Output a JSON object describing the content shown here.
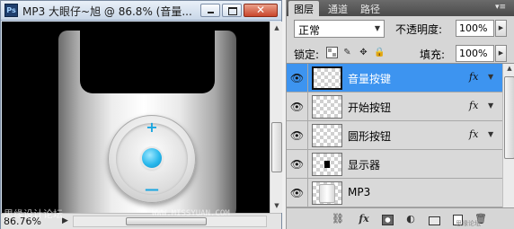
{
  "document": {
    "title": "MP3 大眼仔~旭 @ 86.8% (音量...",
    "zoom": "86.76%",
    "close_glyph": "✕"
  },
  "canvas": {
    "plus_glyph": "+",
    "minus_glyph": "—",
    "accent_color": "#29b8ec"
  },
  "watermark": {
    "left": "思缘设计论坛",
    "right": "WWW.MISSYUAN.COM"
  },
  "panel": {
    "tabs": [
      "图层",
      "通道",
      "路径"
    ],
    "active_tab": "图层",
    "menu_glyph": "▾≡",
    "blend_mode": "正常",
    "opacity_label": "不透明度:",
    "opacity_value": "100%",
    "lock_label": "锁定:",
    "fill_label": "填充:",
    "fill_value": "100%",
    "footer_watermark": "思缘论坛"
  },
  "layers": [
    {
      "name": "音量按键",
      "selected": true,
      "has_fx": true,
      "thumb": "transparent"
    },
    {
      "name": "开始按钮",
      "selected": false,
      "has_fx": true,
      "thumb": "transparent"
    },
    {
      "name": "圆形按钮",
      "selected": false,
      "has_fx": true,
      "thumb": "transparent"
    },
    {
      "name": "显示器",
      "selected": false,
      "has_fx": false,
      "thumb": "black-rect"
    },
    {
      "name": "MP3",
      "selected": false,
      "has_fx": false,
      "thumb": "mp3"
    }
  ],
  "icons": {
    "eye": "eye-icon",
    "fx": "fx"
  }
}
